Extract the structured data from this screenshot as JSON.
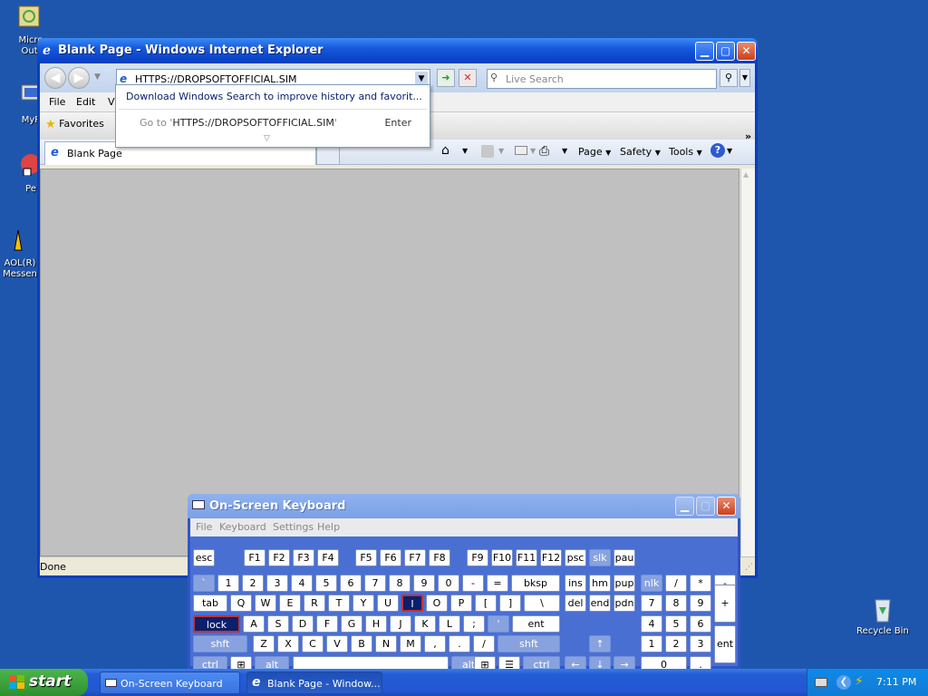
{
  "desktop": {
    "icons": [
      {
        "label": "Micro\nOutl",
        "icon": "outlook-icon"
      },
      {
        "label": "MyP",
        "icon": "computer-icon"
      },
      {
        "label": "Pe",
        "icon": "app-icon"
      },
      {
        "label": "AOL(R)\nMessen",
        "icon": "aol-messenger-icon"
      },
      {
        "label": "Recycle Bin",
        "icon": "recycle-bin-icon"
      }
    ]
  },
  "ie": {
    "title": "Blank Page - Windows Internet Explorer",
    "address": "HTTPS://DROPSOFTOFFICIAL.SIM",
    "search_placeholder": "Live Search",
    "menu": [
      "File",
      "Edit",
      "Vi"
    ],
    "favorites_label": "Favorites",
    "tab_label": "Blank Page",
    "commands": {
      "page": "Page",
      "safety": "Safety",
      "tools": "Tools"
    },
    "status": "Done"
  },
  "dropdown": {
    "hint": "Download Windows Search to improve history and favorit...",
    "goto_prefix": "Go to '",
    "goto_url": "HTTPS://DROPSOFTOFFICIAL.SIM",
    "goto_suffix": "'",
    "enter": "Enter"
  },
  "osk": {
    "title": "On-Screen Keyboard",
    "menu": [
      "File",
      "Keyboard",
      "Settings",
      "Help"
    ],
    "selected_key": "I"
  },
  "taskbar": {
    "start": "start",
    "buttons": [
      {
        "label": "On-Screen Keyboard"
      },
      {
        "label": "Blank Page - Window..."
      }
    ],
    "clock": "7:11 PM"
  },
  "colors": {
    "desktop": "#1f56ad",
    "accent": "#0a3fbf",
    "selected_key": "#0b1f6b"
  }
}
